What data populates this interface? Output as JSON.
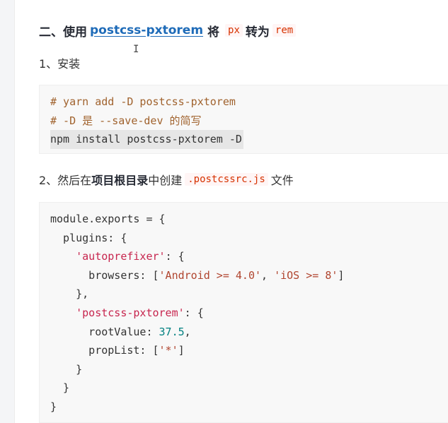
{
  "heading": {
    "prefix": "二、使用",
    "link": "postcss-pxtorem",
    "middle": "将",
    "code_from": "px",
    "to_word": "转为",
    "code_to": "rem"
  },
  "step1": {
    "label": "1、安装"
  },
  "install_block": {
    "lines": [
      "# yarn add -D postcss-pxtorem",
      "# -D 是 --save-dev 的简写",
      "npm install postcss-pxtorem -D"
    ]
  },
  "step2": {
    "prefix": "2、然后在",
    "bold": "项目根目录",
    "middle": "中创建",
    "code": ".postcssrc.js",
    "suffix": "文件"
  },
  "config_block": {
    "line1": "module.exports = {",
    "line2": "  plugins: {",
    "line3_key": "'autoprefixer'",
    "line3_rest": ": {",
    "line4_pre": "      browsers: [",
    "line4_s1": "'Android >= 4.0'",
    "line4_sep": ", ",
    "line4_s2": "'iOS >= 8'",
    "line4_post": "]",
    "line5": "    },",
    "line6_key": "'postcss-pxtorem'",
    "line6_rest": ": {",
    "line7_pre": "      rootValue: ",
    "line7_num": "37.5",
    "line7_post": ",",
    "line8_pre": "      propList: [",
    "line8_str": "'*'",
    "line8_post": "]",
    "line9": "    }",
    "line10": "  }",
    "line11": "}"
  }
}
